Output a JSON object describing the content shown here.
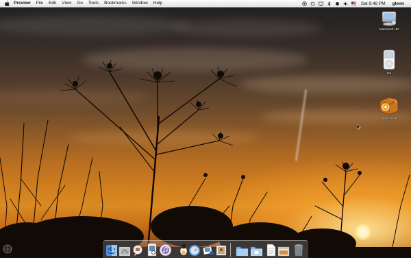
{
  "menubar": {
    "app_name": "Preview",
    "items": [
      "File",
      "Edit",
      "View",
      "Go",
      "Tools",
      "Bookmarks",
      "Window",
      "Help"
    ],
    "status_icons": [
      "network-icon",
      "airport-icon",
      "display-icon",
      "bluetooth-icon",
      "sync-icon",
      "volume-icon",
      "us-flag-icon"
    ],
    "clock": "Sat 9:48 PM",
    "user": "glenn"
  },
  "desktop": {
    "icons": [
      {
        "label": "Macintosh HD",
        "icon": "hard-drive-icon"
      },
      {
        "label": "Ian",
        "icon": "ipod-icon"
      },
      {
        "label": "Disco tools",
        "icon": "disco-package-icon"
      }
    ]
  },
  "dock": {
    "items": [
      {
        "icon": "finder-icon"
      },
      {
        "icon": "mail-stamp-icon"
      },
      {
        "icon": "ichat-icon"
      },
      {
        "icon": "preview-icon"
      },
      {
        "icon": "itunes-icon"
      },
      {
        "icon": "system-preferences-icon"
      },
      {
        "icon": "safari-icon"
      },
      {
        "icon": "iphoto-icon"
      },
      {
        "icon": "photo-booth-icon"
      },
      {
        "icon": "applications-folder-icon"
      },
      {
        "icon": "documents-folder-icon"
      },
      {
        "icon": "text-document-icon"
      },
      {
        "icon": "minimized-window-icon"
      },
      {
        "icon": "trash-icon"
      }
    ]
  },
  "colors": {
    "sky_top": "#1e1e22",
    "sunset": "#d98a22",
    "silhouette": "#120b05"
  }
}
